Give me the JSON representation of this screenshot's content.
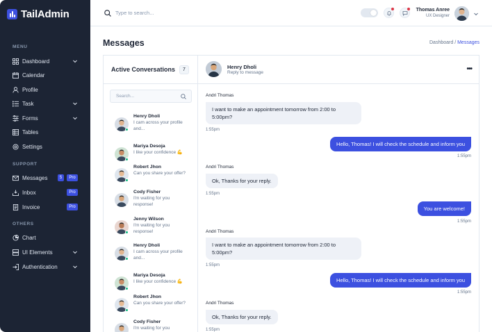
{
  "app": {
    "name": "TailAdmin"
  },
  "colors": {
    "sidebar_bg": "#1c2434",
    "accent": "#3c50e0",
    "online": "#10b981"
  },
  "sidebar": {
    "menu_label": "MENU",
    "menu": [
      {
        "label": "Dashboard",
        "icon": "grid-icon",
        "chevron": true
      },
      {
        "label": "Calendar",
        "icon": "calendar-icon"
      },
      {
        "label": "Profile",
        "icon": "user-icon"
      },
      {
        "label": "Task",
        "icon": "list-icon",
        "chevron": true
      },
      {
        "label": "Forms",
        "icon": "form-icon",
        "chevron": true
      },
      {
        "label": "Tables",
        "icon": "table-icon"
      },
      {
        "label": "Settings",
        "icon": "gear-icon"
      }
    ],
    "support_label": "SUPPORT",
    "support": [
      {
        "label": "Messages",
        "icon": "message-icon",
        "count": "5",
        "badge": "Pro"
      },
      {
        "label": "Inbox",
        "icon": "inbox-icon",
        "badge": "Pro"
      },
      {
        "label": "Invoice",
        "icon": "invoice-icon",
        "badge": "Pro"
      }
    ],
    "others_label": "OTHERS",
    "others": [
      {
        "label": "Chart",
        "icon": "pie-chart-icon"
      },
      {
        "label": "UI Elements",
        "icon": "layers-icon",
        "chevron": true
      },
      {
        "label": "Authentication",
        "icon": "login-icon",
        "chevron": true
      }
    ]
  },
  "header": {
    "search_placeholder": "Type to search...",
    "user_name": "Thomas Anree",
    "user_role": "UX Designer"
  },
  "page": {
    "title": "Messages",
    "breadcrumb_parent": "Dashboard /",
    "breadcrumb_current": "Messages"
  },
  "conversations": {
    "title": "Active Conversations",
    "count": "7",
    "search_placeholder": "Search...",
    "items": [
      {
        "name": "Henry Dholi",
        "message": "I cam across your profile and...",
        "online": true
      },
      {
        "name": "Mariya Desoja",
        "message": "I like your confidence 💪",
        "online": true
      },
      {
        "name": "Robert Jhon",
        "message": "Can you share your offer?",
        "online": true
      },
      {
        "name": "Cody Fisher",
        "message": "I'm waiting for you response!",
        "online": false
      },
      {
        "name": "Jenny Wilson",
        "message": "I'm waiting for you response!",
        "online": true
      },
      {
        "name": "Henry Dholi",
        "message": "I cam across your profile and...",
        "online": true
      },
      {
        "name": "Mariya Desoja",
        "message": "I like your confidence 💪",
        "online": true
      },
      {
        "name": "Robert Jhon",
        "message": "Can you share your offer?",
        "online": true
      },
      {
        "name": "Cody Fisher",
        "message": "I'm waiting for you",
        "online": false
      }
    ]
  },
  "chat": {
    "contact_name": "Henry Dholi",
    "contact_status": "Reply to message",
    "messages": [
      {
        "direction": "in",
        "sender": "Andri Thomas",
        "text": "I want to make an appointment tomorrow from 2:00 to 5:00pm?",
        "time": "1:55pm"
      },
      {
        "direction": "out",
        "text": "Hello, Thomas! I will check the schedule and inform you",
        "time": "1:55pm"
      },
      {
        "direction": "in",
        "sender": "Andri Thomas",
        "text": "Ok, Thanks for your reply.",
        "time": "1:55pm"
      },
      {
        "direction": "out",
        "text": "You are welcome!",
        "time": "1:55pm"
      },
      {
        "direction": "in",
        "sender": "Andri Thomas",
        "text": "I want to make an appointment tomorrow from 2:00 to 5:00pm?",
        "time": "1:55pm"
      },
      {
        "direction": "out",
        "text": "Hello, Thomas! I will check the schedule and inform you",
        "time": "1:55pm"
      },
      {
        "direction": "in",
        "sender": "Andri Thomas",
        "text": "Ok, Thanks for your reply.",
        "time": "1:55pm"
      }
    ]
  }
}
